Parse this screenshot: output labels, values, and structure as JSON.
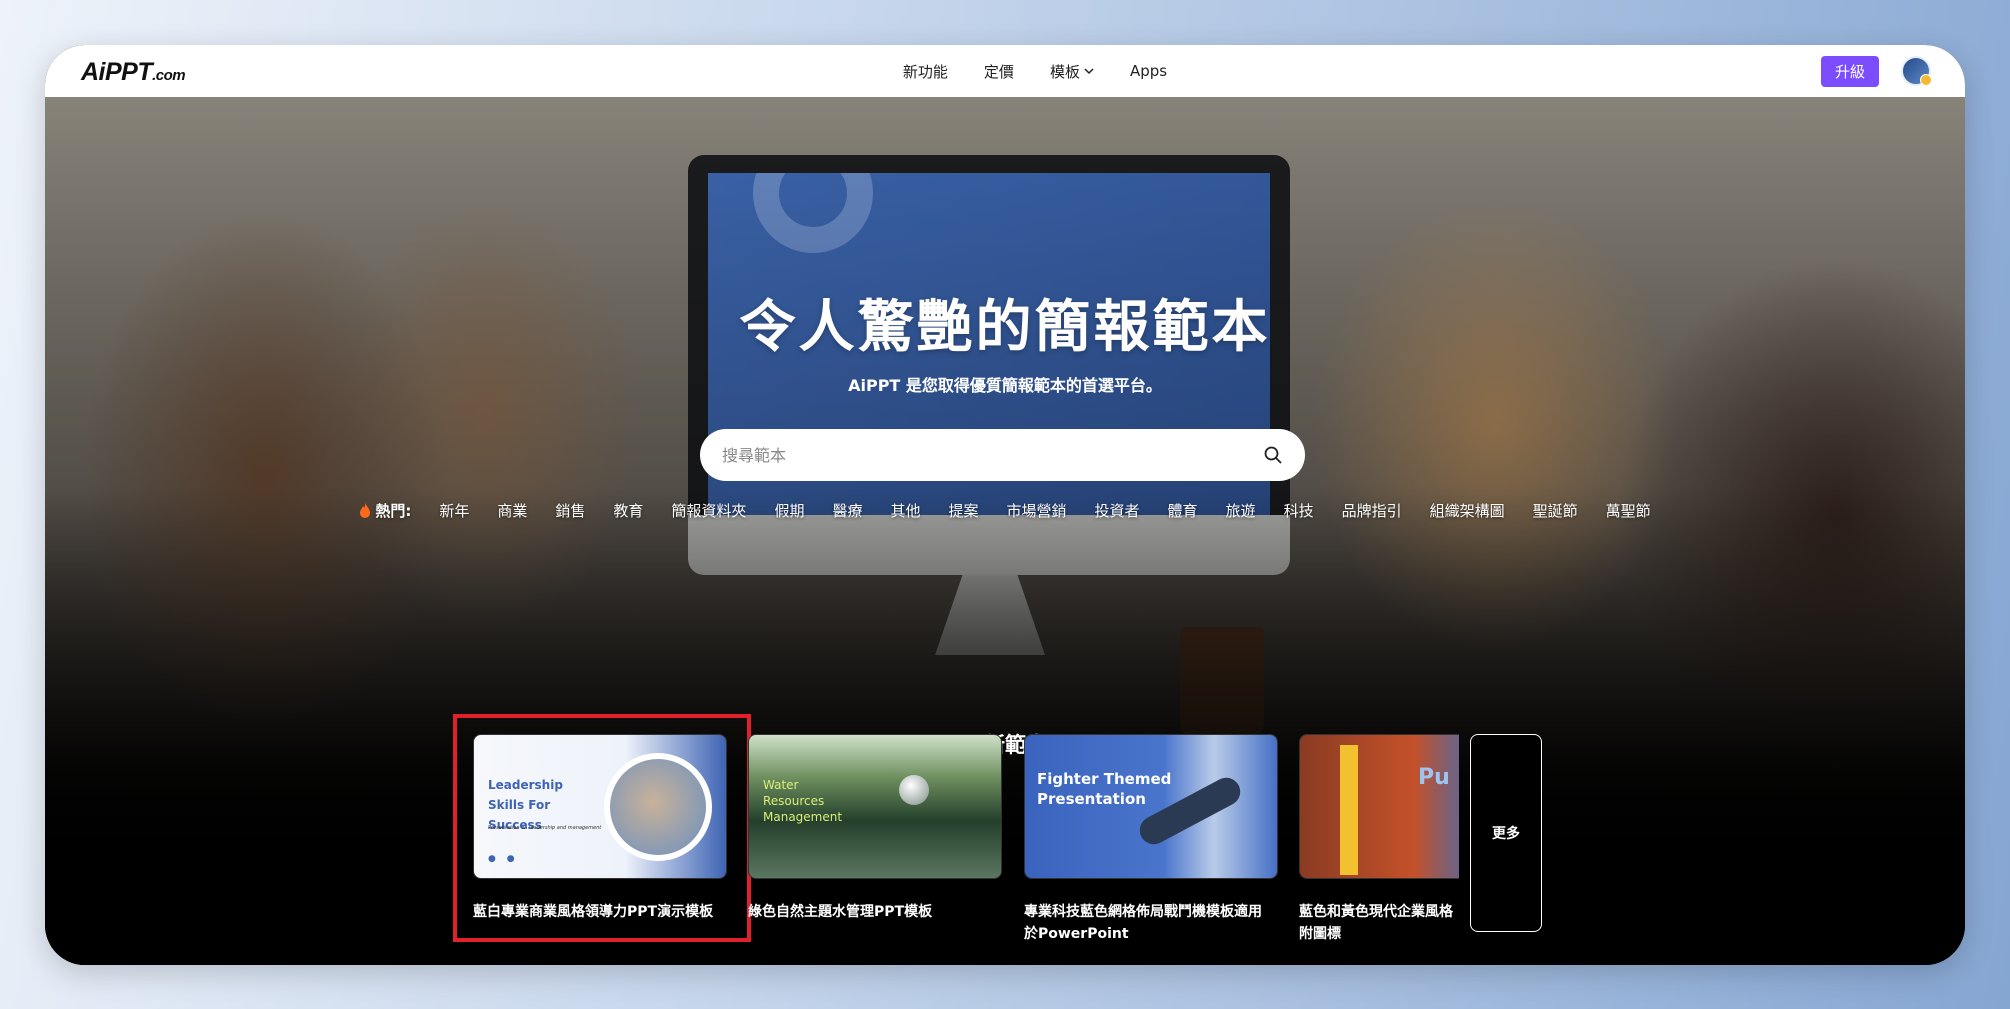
{
  "logo": {
    "brand": "AiPPT",
    "suffix": ".com"
  },
  "nav": {
    "items": [
      {
        "label": "新功能"
      },
      {
        "label": "定價"
      },
      {
        "label": "模板",
        "has_dropdown": true
      },
      {
        "label": "Apps"
      }
    ]
  },
  "header": {
    "upgrade_label": "升級"
  },
  "hero": {
    "title": "令人驚艷的簡報範本",
    "subtitle": "AiPPT 是您取得優質簡報範本的首選平台。",
    "search_placeholder": "搜尋範本"
  },
  "hot": {
    "label": "熱門:",
    "tags": [
      "新年",
      "商業",
      "銷售",
      "教育",
      "簡報資料夾",
      "假期",
      "醫療",
      "其他",
      "提案",
      "市場營銷",
      "投資者",
      "體育",
      "旅遊",
      "科技",
      "品牌指引",
      "組織架構圖",
      "聖誕節",
      "萬聖節"
    ]
  },
  "latest": {
    "title": "最新範本",
    "cards": [
      {
        "name": "藍白專業商業風格領導力PPT演示模板",
        "thumb_title": "Leadership Skills For Success",
        "thumb_sub": "Presentation on leadership and management",
        "thumb_dots": "● ●",
        "selected": true
      },
      {
        "name": "綠色自然主題水管理PPT模板",
        "thumb_title": "Water Resources Management",
        "selected": false
      },
      {
        "name": "專業科技藍色網格佈局戰鬥機模板適用於PowerPoint",
        "thumb_title": "Fighter Themed Presentation",
        "selected": false
      },
      {
        "name": "藍色和黃色現代企業風格附圖標",
        "thumb_title": "Pu",
        "selected": false
      }
    ],
    "more_label": "更多"
  },
  "colors": {
    "accent": "#7c4dff",
    "highlight": "#e0202a"
  }
}
